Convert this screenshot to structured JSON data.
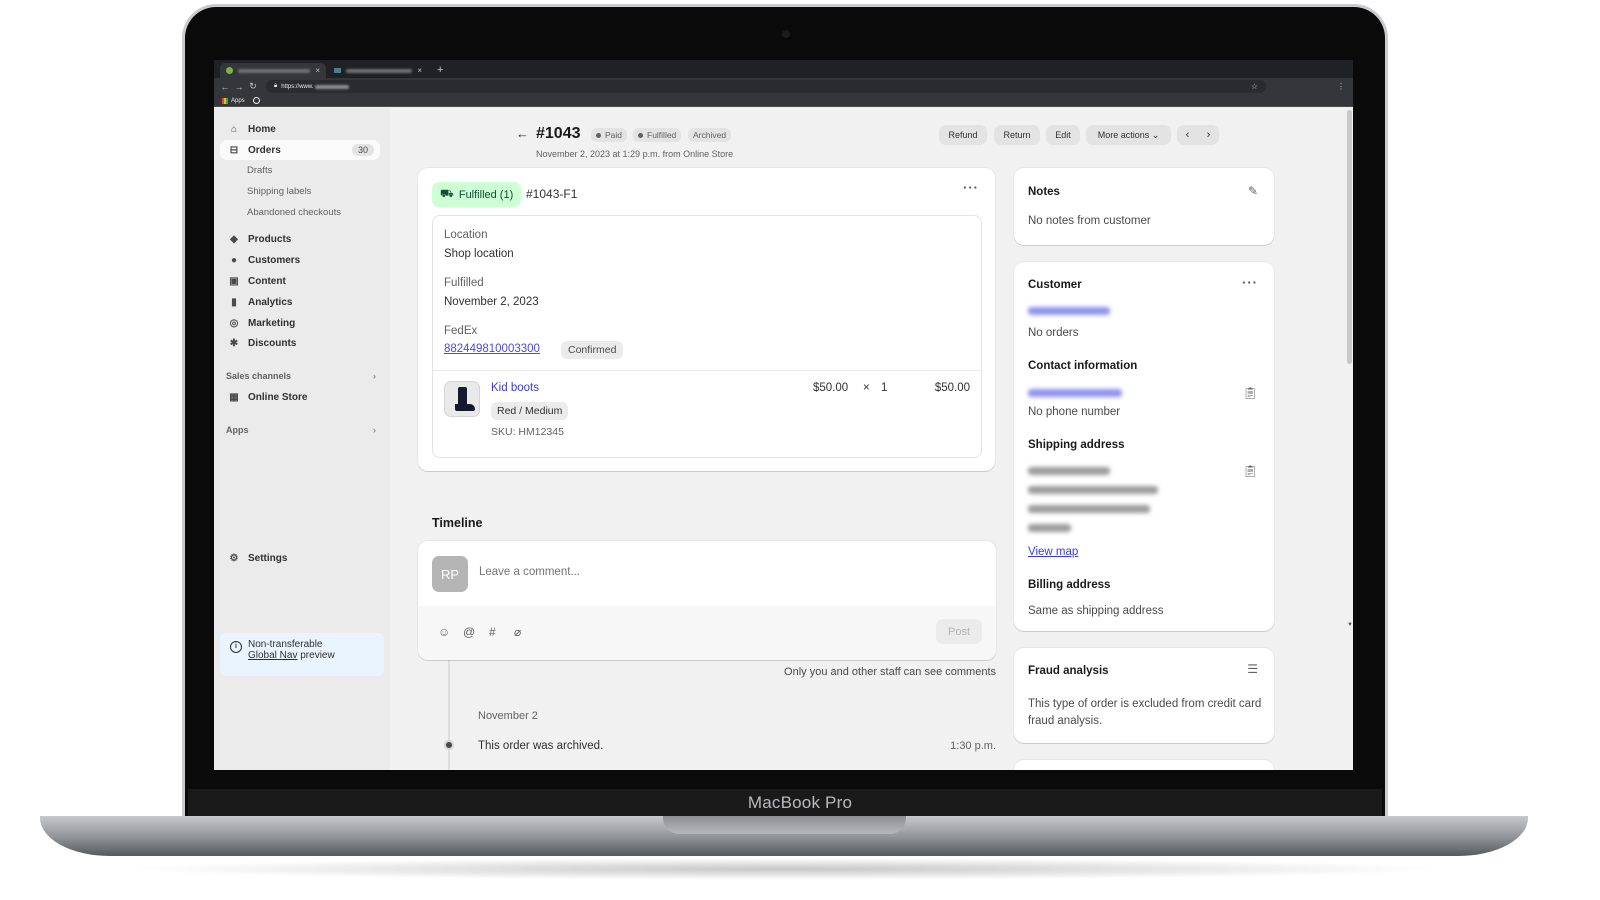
{
  "device": {
    "brand_label": "MacBook Pro"
  },
  "browser": {
    "tabs": [
      {
        "label": "",
        "active": true,
        "close": "×"
      },
      {
        "label": "",
        "active": false,
        "close": "×"
      }
    ],
    "new_tab": "+",
    "url_prefix": "https://www.",
    "bookmarks_apps": "Apps"
  },
  "sidebar": {
    "items": [
      {
        "label": "Home",
        "icon": "home-icon",
        "glyph": "⌂"
      },
      {
        "label": "Orders",
        "icon": "inbox-icon",
        "glyph": "⊟",
        "count": "30",
        "active": true
      },
      {
        "label": "Products",
        "icon": "tag-icon",
        "glyph": "◆"
      },
      {
        "label": "Customers",
        "icon": "person-icon",
        "glyph": "●"
      },
      {
        "label": "Content",
        "icon": "image-icon",
        "glyph": "▣"
      },
      {
        "label": "Analytics",
        "icon": "bar-chart-icon",
        "glyph": "▮"
      },
      {
        "label": "Marketing",
        "icon": "target-icon",
        "glyph": "◎"
      },
      {
        "label": "Discounts",
        "icon": "discount-icon",
        "glyph": "✱"
      }
    ],
    "order_subitems": [
      "Drafts",
      "Shipping labels",
      "Abandoned checkouts"
    ],
    "sales_channels_label": "Sales channels",
    "online_store_label": "Online Store",
    "apps_label": "Apps",
    "chevron": "›",
    "settings_label": "Settings",
    "notice": {
      "line1": "Non-transferable",
      "link": "Global Nav",
      "line2_rest": " preview"
    }
  },
  "header": {
    "back_glyph": "←",
    "title": "#1043",
    "badges": [
      {
        "label": "Paid",
        "dot": true
      },
      {
        "label": "Fulfilled",
        "dot": true
      },
      {
        "label": "Archived",
        "dot": false
      }
    ],
    "subtitle": "November 2, 2023 at 1:29 p.m. from Online Store",
    "actions": {
      "refund": "Refund",
      "return": "Return",
      "edit": "Edit",
      "more": "More actions ⌄"
    },
    "pager": {
      "prev": "‹",
      "next": "›"
    }
  },
  "fulfillment": {
    "status": "Fulfilled (1)",
    "id": "#1043-F1",
    "location_label": "Location",
    "location_value": "Shop location",
    "fulfilled_label": "Fulfilled",
    "fulfilled_value": "November 2, 2023",
    "carrier": "FedEx",
    "tracking_number": "882449810003300",
    "tracking_status": "Confirmed",
    "line_item": {
      "name": "Kid boots",
      "variant": "Red / Medium",
      "sku": "SKU: HM12345",
      "unit_price": "$50.00",
      "times": "×",
      "quantity": "1",
      "total": "$50.00"
    }
  },
  "timeline": {
    "title": "Timeline",
    "avatar_initials": "RP",
    "comment_placeholder": "Leave a comment...",
    "post_label": "Post",
    "tools": {
      "emoji": "☺",
      "mention": "@",
      "hashtag": "#",
      "attach": "⌀"
    },
    "staff_note": "Only you and other staff can see comments",
    "events": [
      {
        "date": "November 2",
        "text": "This order was archived.",
        "time": "1:30 p.m."
      }
    ]
  },
  "notes": {
    "title": "Notes",
    "text": "No notes from customer"
  },
  "customer": {
    "title": "Customer",
    "orders_text": "No orders",
    "contact_title": "Contact information",
    "phone_text": "No phone number",
    "shipping_title": "Shipping address",
    "view_map": "View map",
    "billing_title": "Billing address",
    "billing_text": "Same as shipping address"
  },
  "fraud": {
    "title": "Fraud analysis",
    "text": "This type of order is excluded from credit card fraud analysis."
  }
}
